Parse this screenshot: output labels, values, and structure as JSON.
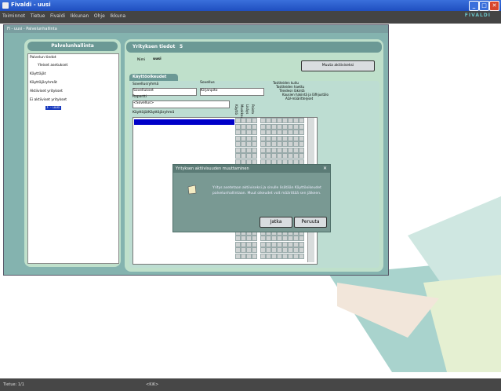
{
  "app": {
    "title": "Fivaldi - uusi",
    "brand": "FIVALDI",
    "menu": [
      "Toiminnot",
      "Tietue",
      "Fivaldi",
      "Ikkunan",
      "Ohje",
      "Ikkuna"
    ]
  },
  "window": {
    "title": "Fi - uusi - Palvelunhallinta"
  },
  "left_panel": {
    "header": "Palvelunhallinta",
    "tree": [
      {
        "label": "Palvelun tiedot",
        "level": 0
      },
      {
        "label": "Yleiset asetukset",
        "level": 1
      },
      {
        "label": "Käyttäjät",
        "level": 0
      },
      {
        "label": "Käyttäjäryhmät",
        "level": 0
      },
      {
        "label": "Aktiiviset yritykset",
        "level": 0
      },
      {
        "label": "Ei aktiiviset yritykset",
        "level": 0
      },
      {
        "label": "F - uusi",
        "level": 1
      }
    ]
  },
  "right_panel": {
    "header": "Yrityksen tiedot",
    "header_value": "5",
    "name_label": "Nimi",
    "name_value": "uusi",
    "change_button": "Muuta aktiiviseksi",
    "tab": "Käyttöoikeudet",
    "sovellusryhma_label": "Sovellusryhmä",
    "sovellusryhma_value": "Sovellukset",
    "sovellus_label": "Sovellus",
    "sovellus_value": "Kirjanpito",
    "raportti_label": "Raportti",
    "raportti_value": "<Sovellus>",
    "grid_label": "Käyttäjä/Käyttäjäryhmä",
    "col_headers": [
      "Käyttö",
      "Muokkaus",
      "Lisäys",
      "Poisto"
    ],
    "report_labels": [
      "Tositteiden kuitu",
      "Tositteiden haettu",
      "Tileidesn läkintä",
      "Kausien hakintä ja läfhjustälo",
      "ALV-määrittelyset"
    ]
  },
  "dialog": {
    "title": "Yrityksen aktiivisuuden muuttaminen",
    "message": "Yritys asetetaan aktiiviseksi ja sinulle lisätään Käyttöoikeudet palvelunhallintaan. Muut oikeudet voit määrittää sen jälkeen.",
    "ok_button": "Jatka",
    "cancel_button": "Peruuta"
  },
  "status": {
    "record": "Tietue: 1/1",
    "mode": "<KiK>"
  }
}
